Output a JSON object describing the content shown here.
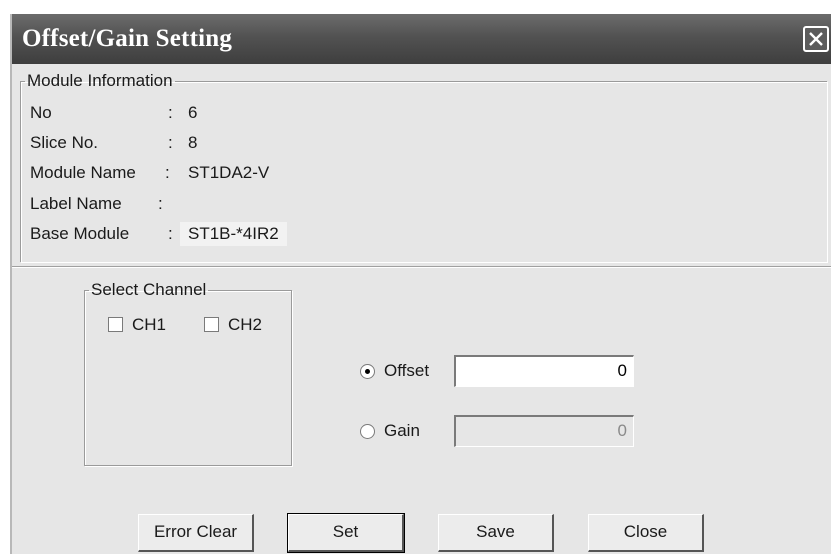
{
  "window": {
    "title": "Offset/Gain Setting",
    "close_icon": "close-icon"
  },
  "module_info": {
    "legend": "Module Information",
    "rows": [
      {
        "label": "No",
        "colon": ":",
        "value": "6"
      },
      {
        "label": "Slice No.",
        "colon": ":",
        "value": "8"
      },
      {
        "label": "Module Name",
        "colon": ":",
        "value": "ST1DA2-V"
      },
      {
        "label": "Label Name",
        "colon": ":",
        "value": ""
      },
      {
        "label": "Base Module",
        "colon": ":",
        "value": "ST1B-*4IR2"
      }
    ]
  },
  "select_channel": {
    "legend": "Select Channel",
    "channels": [
      {
        "label": "CH1",
        "checked": false
      },
      {
        "label": "CH2",
        "checked": false
      }
    ]
  },
  "adjust": {
    "offset": {
      "label": "Offset",
      "selected": true,
      "value": "0"
    },
    "gain": {
      "label": "Gain",
      "selected": false,
      "value": "0"
    }
  },
  "buttons": {
    "error_clear": "Error Clear",
    "set": "Set",
    "save": "Save",
    "close": "Close"
  }
}
